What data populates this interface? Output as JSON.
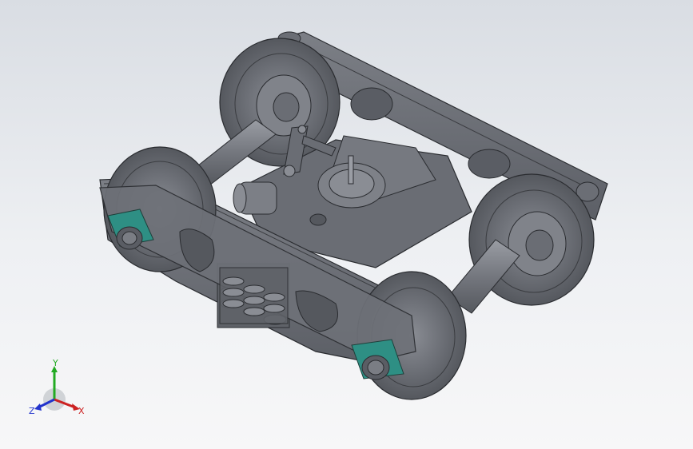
{
  "triad": {
    "x_label": "X",
    "y_label": "Y",
    "z_label": "Z",
    "x_color": "#cc2222",
    "y_color": "#22aa22",
    "z_color": "#2233cc"
  },
  "model": {
    "body_color": "#6f727a",
    "accent_color": "#2e8f84",
    "edge_color": "#2a2c30"
  }
}
